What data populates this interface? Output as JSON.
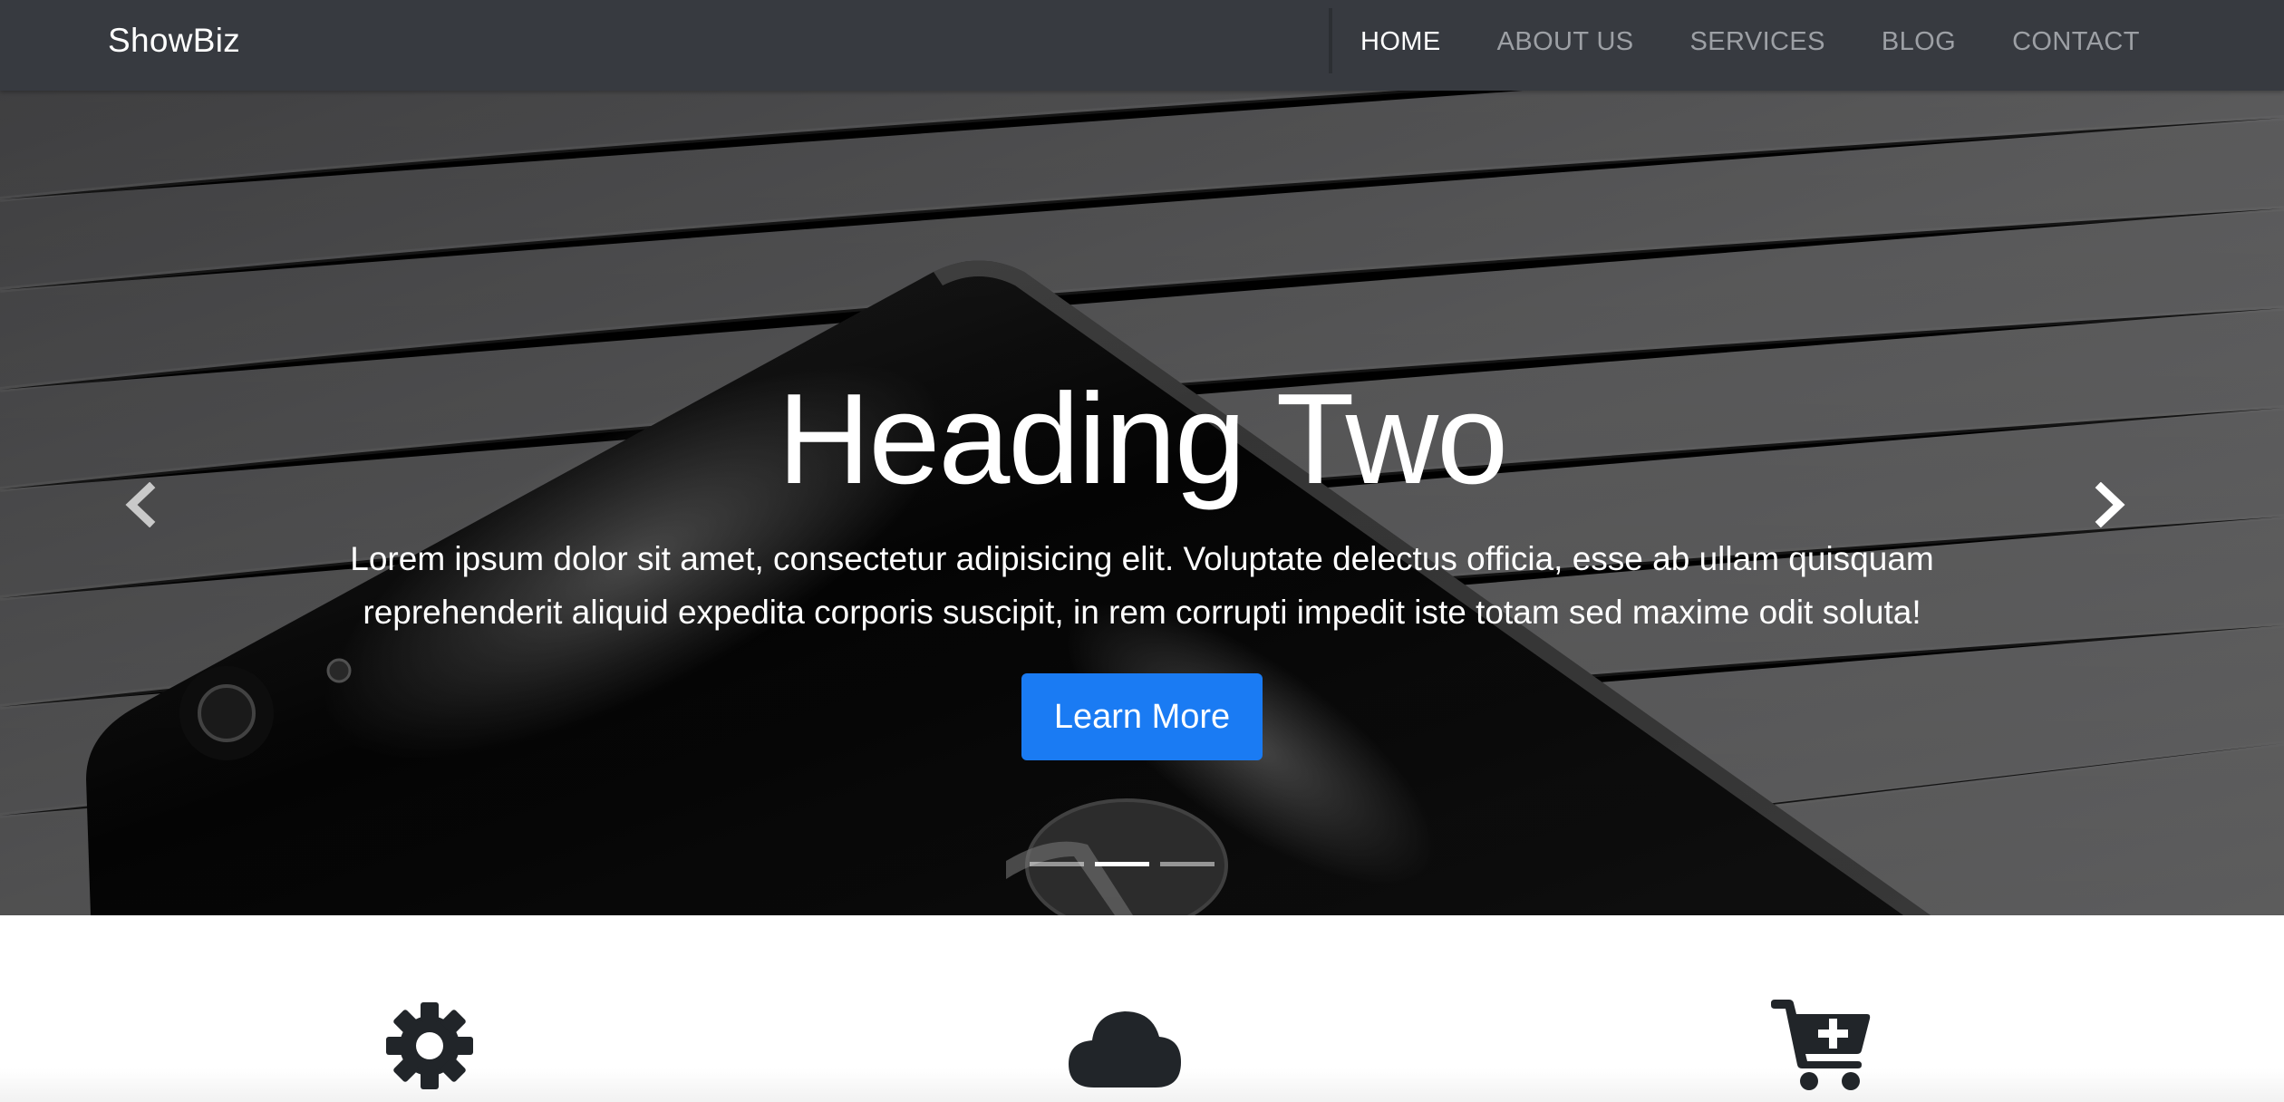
{
  "navbar": {
    "brand": "ShowBiz",
    "links": [
      {
        "label": "HOME",
        "active": true
      },
      {
        "label": "ABOUT US",
        "active": false
      },
      {
        "label": "SERVICES",
        "active": false
      },
      {
        "label": "BLOG",
        "active": false
      },
      {
        "label": "CONTACT",
        "active": false
      }
    ]
  },
  "hero": {
    "heading": "Heading Two",
    "text": "Lorem ipsum dolor sit amet, consectetur adipisicing elit. Voluptate delectus officia, esse ab ullam quisquam reprehenderit aliquid expedita corporis suscipit, in rem corrupti impedit iste totam sed maxime odit soluta!",
    "button_label": "Learn More",
    "prev_icon": "chevron-left-icon",
    "next_icon": "chevron-right-icon",
    "slide_count": 3,
    "active_slide": 2
  },
  "features": {
    "icons": [
      "gear-icon",
      "cloud-icon",
      "cart-plus-icon"
    ]
  },
  "colors": {
    "navbar_bg": "#373a40",
    "nav_link": "#9da0a5",
    "nav_link_active": "#ffffff",
    "button_bg": "#1a7bf3",
    "icon_color": "#212529"
  }
}
